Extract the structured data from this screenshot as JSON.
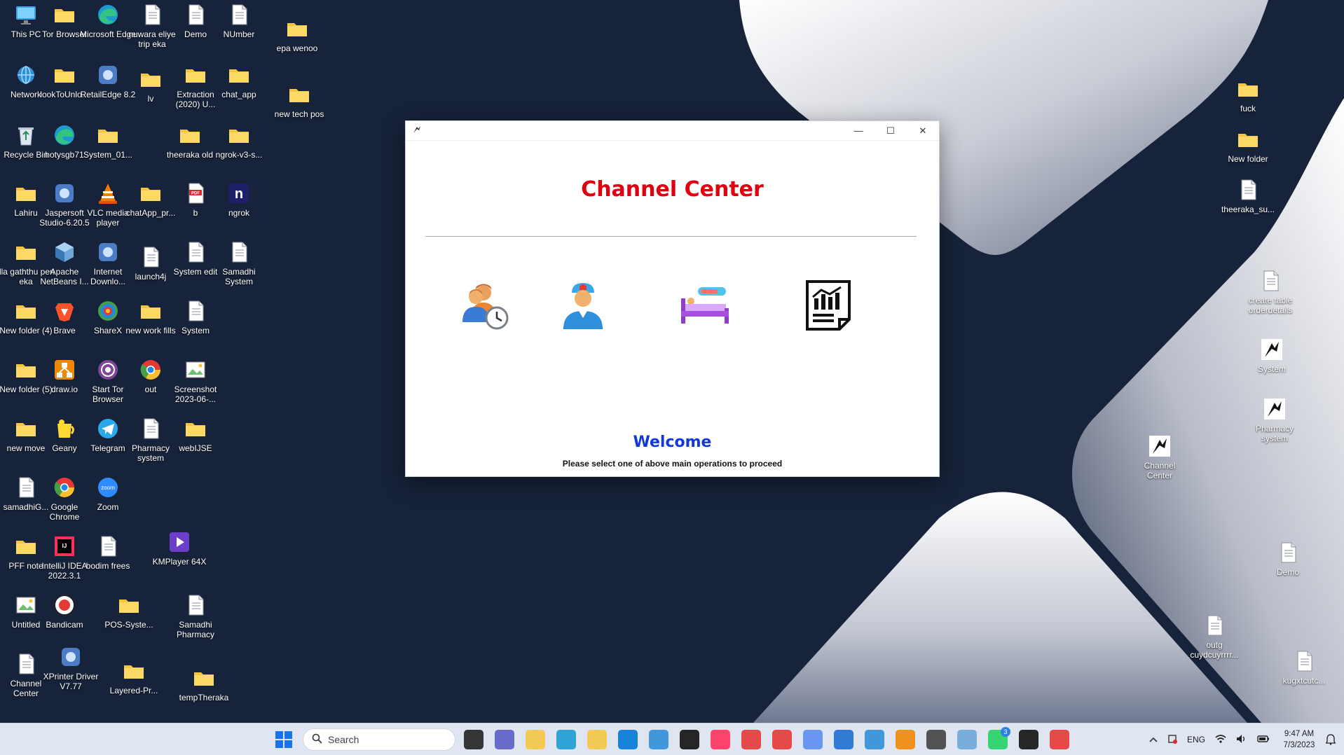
{
  "desktop": {
    "icons": [
      {
        "label": "This PC",
        "icon": "monitor-icon"
      },
      {
        "label": "Tor Browser",
        "icon": "folder-icon"
      },
      {
        "label": "Microsoft Edge",
        "icon": "edge-icon"
      },
      {
        "label": "nuwara eliye trip eka",
        "icon": "document-icon"
      },
      {
        "label": "Demo",
        "icon": "document-icon"
      },
      {
        "label": "NUmber",
        "icon": "document-icon"
      },
      {
        "label": "epa wenoo",
        "icon": "folder-icon"
      },
      {
        "label": "Network",
        "icon": "network-icon"
      },
      {
        "label": "lookToUnlo...",
        "icon": "folder-icon"
      },
      {
        "label": "RetailEdge 8.2",
        "icon": "app-icon"
      },
      {
        "label": "lv",
        "icon": "folder-icon"
      },
      {
        "label": "Extraction (2020) U...",
        "icon": "folder-icon"
      },
      {
        "label": "chat_app",
        "icon": "folder-icon"
      },
      {
        "label": "new tech pos",
        "icon": "folder-icon"
      },
      {
        "label": "Recycle Bin",
        "icon": "recycle-bin-icon"
      },
      {
        "label": "hotysgb71",
        "icon": "edge-icon"
      },
      {
        "label": "System_01...",
        "icon": "folder-icon"
      },
      {
        "label": "theeraka old",
        "icon": "folder-icon"
      },
      {
        "label": "ngrok-v3-s...",
        "icon": "folder-icon"
      },
      {
        "label": "Lahiru",
        "icon": "folder-icon"
      },
      {
        "label": "Jaspersoft Studio-6.20.5",
        "icon": "app-icon"
      },
      {
        "label": "VLC media player",
        "icon": "vlc-icon"
      },
      {
        "label": "chatApp_pr...",
        "icon": "folder-icon"
      },
      {
        "label": "b",
        "icon": "pdf-icon"
      },
      {
        "label": "ngrok",
        "icon": "ngrok-icon"
      },
      {
        "label": "illa gaththu pen eka",
        "icon": "folder-icon"
      },
      {
        "label": "Apache NetBeans I...",
        "icon": "netbeans-icon"
      },
      {
        "label": "Internet Downlo...",
        "icon": "app-icon"
      },
      {
        "label": "launch4j",
        "icon": "document-icon"
      },
      {
        "label": "System edit",
        "icon": "document-icon"
      },
      {
        "label": "Samadhi System",
        "icon": "document-icon"
      },
      {
        "label": "New folder (4)",
        "icon": "folder-icon"
      },
      {
        "label": "Brave",
        "icon": "brave-icon"
      },
      {
        "label": "ShareX",
        "icon": "sharex-icon"
      },
      {
        "label": "new work fills",
        "icon": "folder-icon"
      },
      {
        "label": "System",
        "icon": "document-icon"
      },
      {
        "label": "New folder (5)",
        "icon": "folder-icon"
      },
      {
        "label": "draw.io",
        "icon": "drawio-icon"
      },
      {
        "label": "Start Tor Browser",
        "icon": "tor-icon"
      },
      {
        "label": "out",
        "icon": "chrome-icon"
      },
      {
        "label": "Screenshot 2023-06-...",
        "icon": "image-icon"
      },
      {
        "label": "new move",
        "icon": "folder-icon"
      },
      {
        "label": "Geany",
        "icon": "geany-icon"
      },
      {
        "label": "Telegram",
        "icon": "telegram-icon"
      },
      {
        "label": "Pharmacy system",
        "icon": "document-icon"
      },
      {
        "label": "webIJSE",
        "icon": "folder-icon"
      },
      {
        "label": "samadhiG...",
        "icon": "document-icon"
      },
      {
        "label": "Google Chrome",
        "icon": "chrome-icon"
      },
      {
        "label": "Zoom",
        "icon": "zoom-icon"
      },
      {
        "label": "PFF note",
        "icon": "folder-icon"
      },
      {
        "label": "IntelliJ IDEA 2022.3.1",
        "icon": "intellij-icon"
      },
      {
        "label": "bodim frees",
        "icon": "document-icon"
      },
      {
        "label": "KMPlayer 64X",
        "icon": "kmplayer-icon"
      },
      {
        "label": "Untitled",
        "icon": "image-icon"
      },
      {
        "label": "Bandicam",
        "icon": "bandicam-icon"
      },
      {
        "label": "POS-Syste...",
        "icon": "folder-icon"
      },
      {
        "label": "Samadhi Pharmacy",
        "icon": "document-icon"
      },
      {
        "label": "Channel Center",
        "icon": "document-icon"
      },
      {
        "label": "XPrinter Driver V7.77",
        "icon": "app-icon"
      },
      {
        "label": "Layered-Pr...",
        "icon": "folder-icon"
      },
      {
        "label": "tempTheraka",
        "icon": "folder-icon"
      },
      {
        "label": "fuck",
        "icon": "folder-icon"
      },
      {
        "label": "New folder",
        "icon": "folder-icon"
      },
      {
        "label": "theeraka_su...",
        "icon": "document-icon"
      },
      {
        "label": "create table orderdetails",
        "icon": "document-icon"
      },
      {
        "label": "System",
        "icon": "java-app-icon"
      },
      {
        "label": "Pharmacy system",
        "icon": "java-app-icon"
      },
      {
        "label": "Channel Center",
        "icon": "java-app-icon"
      },
      {
        "label": "Demo",
        "icon": "document-icon"
      },
      {
        "label": "outg cuydcuyrrrr...",
        "icon": "document-icon"
      },
      {
        "label": "kugxtcutc...",
        "icon": "document-icon"
      }
    ]
  },
  "window": {
    "title": "Channel Center",
    "controls": {
      "minimize": "—",
      "maximize": "☐",
      "close": "✕"
    },
    "operations": [
      {
        "name": "appointment-scheduling",
        "icon": "patients-clock-icon"
      },
      {
        "name": "doctor-management",
        "icon": "doctor-icon"
      },
      {
        "name": "admission-management",
        "icon": "hospital-bed-icon"
      },
      {
        "name": "reports",
        "icon": "report-chart-icon"
      }
    ],
    "welcome": "Welcome",
    "subtitle": "Please select one of above main operations to proceed"
  },
  "taskbar": {
    "search_placeholder": "Search",
    "apps": [
      "file-explorer",
      "edge",
      "vscode",
      "intellij",
      "chrome",
      "whatsapp",
      "snipping-tool"
    ],
    "whatsapp_badge": "3",
    "language": "ENG",
    "time": "9:47 AM",
    "date": "7/3/2023"
  },
  "colors": {
    "desktop_bg": "#17233a",
    "title_red": "#e00010",
    "welcome_blue": "#1238d8"
  }
}
